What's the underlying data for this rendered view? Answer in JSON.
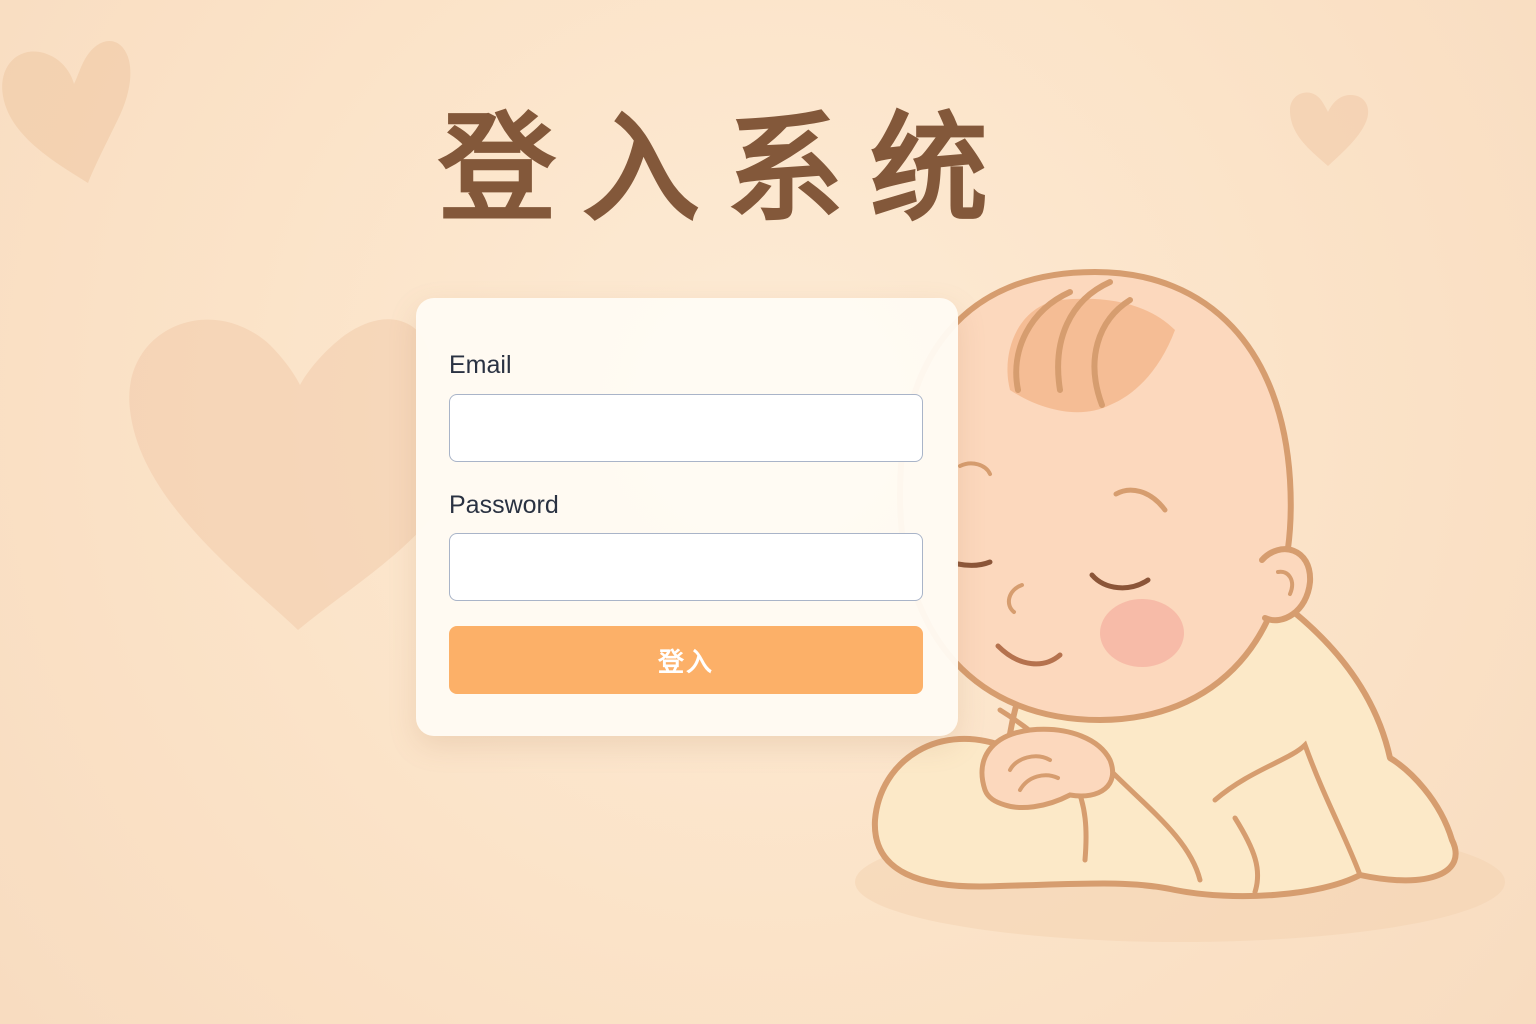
{
  "page": {
    "title": "登入系统",
    "background_color": "#fbe4c9",
    "accent_color": "#fcb068",
    "title_color": "#83583a"
  },
  "form": {
    "email_label": "Email",
    "email_value": "",
    "email_placeholder": "",
    "password_label": "Password",
    "password_value": "",
    "password_placeholder": "",
    "submit_label": "登入"
  },
  "decorations": {
    "icons": [
      "heart-icon",
      "heart-icon",
      "heart-icon",
      "sleeping-baby-illustration"
    ],
    "heart_color": "#f1c9a6",
    "baby_outline_color": "#d49a6a",
    "baby_skin_color": "#fbd8bf",
    "baby_clothes_color": "#fcebc9"
  }
}
